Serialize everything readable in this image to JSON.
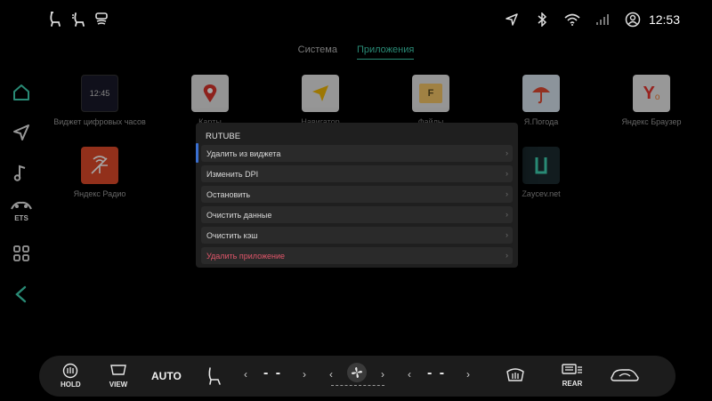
{
  "status_bar": {
    "time": "12:53",
    "left_icons": [
      "seat-heating-icon",
      "seat-ventilation-icon",
      "steering-wheel-heat-icon"
    ],
    "right_icons": [
      "navigation-arrow-icon",
      "bluetooth-icon",
      "wifi-icon",
      "signal-icon",
      "account-icon"
    ]
  },
  "sidebar": {
    "items": [
      {
        "icon": "home-icon",
        "active": true
      },
      {
        "icon": "navigation-icon"
      },
      {
        "icon": "music-icon"
      },
      {
        "icon": "ets-icon",
        "label": "ETS"
      },
      {
        "icon": "apps-grid-icon"
      },
      {
        "icon": "back-icon"
      }
    ]
  },
  "tabs": [
    {
      "label": "Система",
      "active": false
    },
    {
      "label": "Приложения",
      "active": true
    }
  ],
  "apps": [
    {
      "label": "Виджет цифровых часов",
      "icon_text": "12:45"
    },
    {
      "label": "Карты"
    },
    {
      "label": "Навигатор"
    },
    {
      "label": "Файлы",
      "icon_text": "F"
    },
    {
      "label": "Я.Погода"
    },
    {
      "label": "Яндекс Браузер"
    },
    {
      "label": "Яндекс Радио"
    },
    {
      "label": "Zaycev.net"
    }
  ],
  "context_menu": {
    "title": "RUTUBE",
    "items": [
      {
        "label": "Удалить из виджета",
        "selected": true
      },
      {
        "label": "Изменить DPI"
      },
      {
        "label": "Остановить"
      },
      {
        "label": "Очистить данные"
      },
      {
        "label": "Очистить кэш"
      },
      {
        "label": "Удалить приложение",
        "danger": true
      }
    ],
    "chevron": "›"
  },
  "climate": {
    "hold_label": "HOLD",
    "view_label": "VIEW",
    "auto_label": "AUTO",
    "left_temp": "- -",
    "right_temp": "- -",
    "rear_label": "REAR",
    "arrow_left": "‹",
    "arrow_right": "›"
  },
  "colors": {
    "accent": "#3fd4b4",
    "danger": "#e0566a",
    "selection": "#3a6fd0"
  }
}
